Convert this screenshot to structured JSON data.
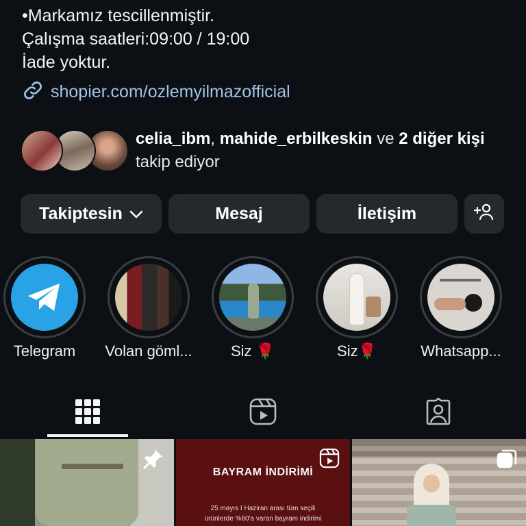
{
  "bio": {
    "lines": [
      "•Markamız tescillenmiştir.",
      "Çalışma saatleri:09:00 / 19:00",
      "İade yoktur."
    ],
    "link": "shopier.com/ozlemyilmazofficial"
  },
  "followed_by": {
    "user1": "celia_ibm",
    "separator": ", ",
    "user2": "mahide_erbilkeskin",
    "ve": " ve ",
    "others_bold": "2 diğer kişi",
    "suffix": " takip ediyor"
  },
  "actions": {
    "following_label": "Takiptesin",
    "message_label": "Mesaj",
    "contact_label": "İletişim"
  },
  "highlights": [
    {
      "label": "Telegram"
    },
    {
      "label": "Volan göml..."
    },
    {
      "label": "Siz 🌹"
    },
    {
      "label": "Siz🌹"
    },
    {
      "label": "Whatsapp..."
    }
  ],
  "grid": {
    "post2_title": "BAYRAM İNDİRİMİ",
    "post2_sub1": "25 mayıs I Haziran arası tüm seçili",
    "post2_sub2": "ürünlerde %60'a varan bayram indirimi"
  },
  "colors": {
    "background": "#0c1014",
    "button": "#25292e",
    "link": "#9fc4ec",
    "telegram": "#2aa3e6",
    "promo_red": "#5a0f10"
  }
}
